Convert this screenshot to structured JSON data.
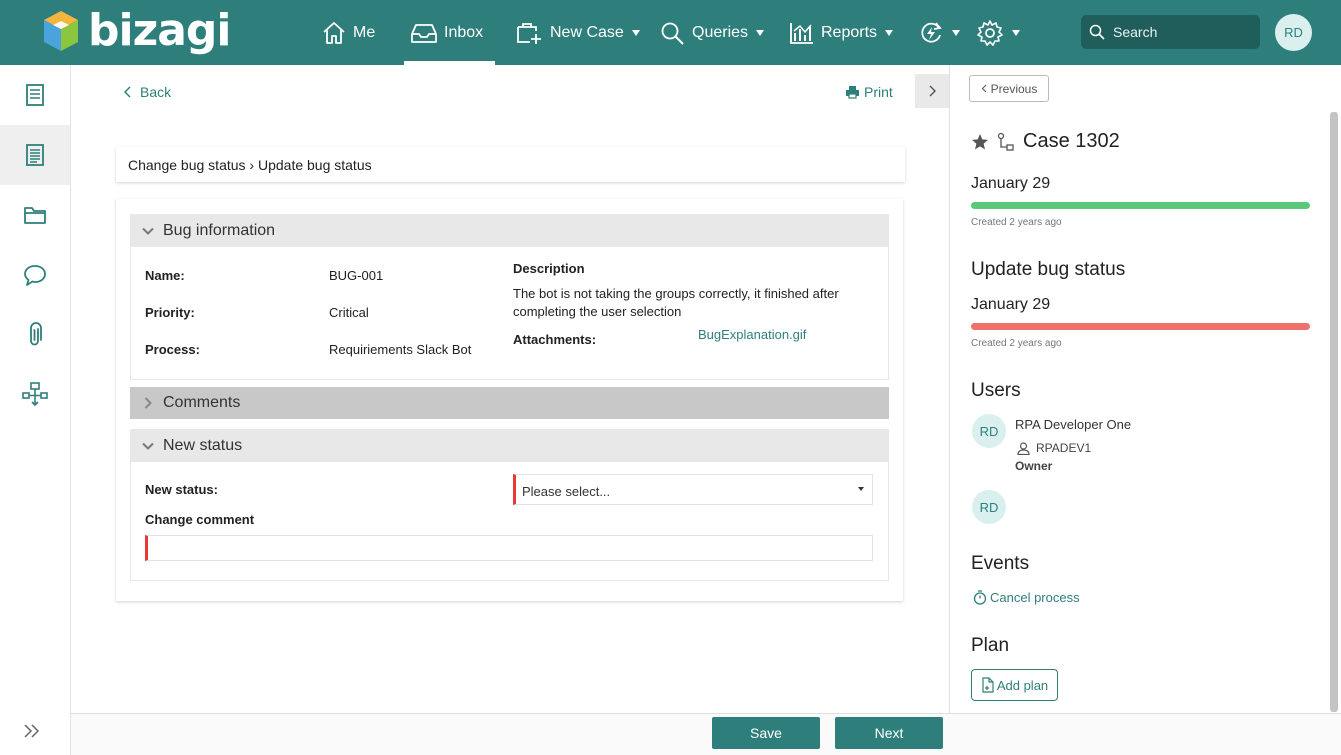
{
  "colors": {
    "brand": "#2e7f7b",
    "progress_green": "#5ac97b",
    "progress_red": "#f0706c",
    "required": "#e53935"
  },
  "header": {
    "logo_text": "bizagi",
    "nav": [
      {
        "label": "Me",
        "icon": "home-icon"
      },
      {
        "label": "Inbox",
        "icon": "inbox-icon"
      },
      {
        "label": "New Case",
        "icon": "new-case-icon"
      },
      {
        "label": "Queries",
        "icon": "search-icon"
      },
      {
        "label": "Reports",
        "icon": "chart-icon"
      }
    ],
    "search_placeholder": "Search",
    "user_initials": "RD"
  },
  "left_rail": {
    "icons": [
      "form-icon",
      "list-icon",
      "folder-icon",
      "comment-icon",
      "attachment-icon",
      "process-map-icon"
    ],
    "expand_icon": "double-chevron-icon"
  },
  "main": {
    "back_label": "Back",
    "print_label": "Print",
    "breadcrumb": "Change bug status › Update bug status",
    "bug_info": {
      "title": "Bug information",
      "name_label": "Name:",
      "name_value": "BUG-001",
      "priority_label": "Priority:",
      "priority_value": "Critical",
      "process_label": "Process:",
      "process_value": "Requiriements Slack Bot",
      "description_label": "Description",
      "description_value": "The bot is not taking the groups correctly, it finished after completing the user selection",
      "attachments_label": "Attachments:",
      "attachment_file": "BugExplanation.gif"
    },
    "comments": {
      "title": "Comments"
    },
    "new_status": {
      "title": "New status",
      "status_label": "New status:",
      "status_placeholder": "Please select...",
      "comment_label": "Change comment"
    }
  },
  "footer": {
    "save_label": "Save",
    "next_label": "Next"
  },
  "right_panel": {
    "previous_label": "Previous",
    "case_title": "Case 1302",
    "case_date": "January 29",
    "case_created": "Created 2 years ago",
    "case_progress": 1.0,
    "task_title": "Update bug status",
    "task_date": "January 29",
    "task_created": "Created 2 years ago",
    "task_progress": 1.0,
    "users_title": "Users",
    "users": [
      {
        "initials": "RD",
        "name": "RPA Developer One",
        "id": "RPADEV1",
        "role": "Owner"
      },
      {
        "initials": "RD"
      }
    ],
    "events_title": "Events",
    "cancel_process_label": "Cancel process",
    "plan_title": "Plan",
    "add_plan_label": "Add plan"
  }
}
